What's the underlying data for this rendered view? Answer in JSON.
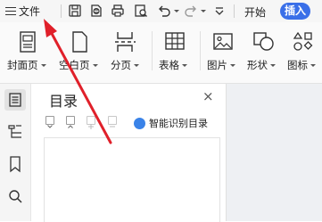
{
  "menu": {
    "file_label": "文件"
  },
  "quick_access": {
    "icons": [
      "save-icon",
      "export-pdf-icon",
      "print-icon",
      "print-preview-icon",
      "undo-icon",
      "redo-icon",
      "more-chevron-icon"
    ]
  },
  "tabs": {
    "start_label": "开始",
    "insert_label": "插入",
    "insert_color": "#3a6fe8"
  },
  "ribbon": {
    "items": [
      {
        "label": "封面页",
        "icon": "cover-page-icon"
      },
      {
        "label": "空白页",
        "icon": "blank-page-icon"
      },
      {
        "label": "分页",
        "icon": "page-break-icon"
      },
      {
        "label": "表格",
        "icon": "table-icon"
      },
      {
        "label": "图片",
        "icon": "picture-icon"
      },
      {
        "label": "形状",
        "icon": "shape-icon"
      },
      {
        "label": "图标",
        "icon": "icons-icon"
      }
    ]
  },
  "left_sidebar": {
    "icons": [
      "outline-icon",
      "navigation-icon",
      "bookmark-icon",
      "search-icon"
    ]
  },
  "toc_panel": {
    "title": "目录",
    "close_symbol": "×",
    "smart_toc_label": "智能识别目录"
  },
  "annotation": {
    "arrow_color": "#e0202a"
  }
}
